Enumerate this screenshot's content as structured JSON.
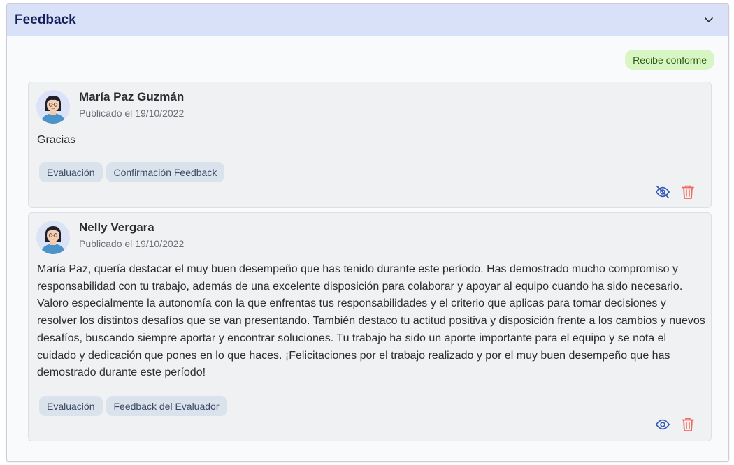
{
  "panel": {
    "title": "Feedback",
    "status": "Recibe conforme",
    "colors": {
      "header_bg": "#d9e1f8",
      "title": "#14205a",
      "badge_bg": "#d8f5c4",
      "badge_text": "#2e5b13",
      "icon_blue": "#3357b8",
      "icon_red": "#f26a5e"
    },
    "icons": {
      "toggle": "chevron-down-icon"
    }
  },
  "comments": [
    {
      "author": "María Paz Guzmán",
      "published": "Publicado el 19/10/2022",
      "text": "Gracias",
      "tags": [
        "Evaluación",
        "Confirmación Feedback"
      ],
      "actions": {
        "visibility_icon": "eye-off-icon",
        "delete_icon": "trash-icon"
      }
    },
    {
      "author": "Nelly Vergara",
      "published": "Publicado el 19/10/2022",
      "text": "María Paz, quería destacar el muy buen desempeño que has tenido durante este período. Has demostrado mucho compromiso y responsabilidad con tu trabajo, además de una excelente disposición para colaborar y apoyar al equipo cuando ha sido necesario. Valoro especialmente la autonomía con la que enfrentas tus responsabilidades y el criterio que aplicas para tomar decisiones y resolver los distintos desafíos que se van presentando. También destaco tu actitud positiva y disposición frente a los cambios y nuevos desafíos, buscando siempre aportar y encontrar soluciones. Tu trabajo ha sido un aporte importante para el equipo y se nota el cuidado y dedicación que pones en lo que haces. ¡Felicitaciones por el trabajo realizado y por el muy buen desempeño que has demostrado durante este período!",
      "tags": [
        "Evaluación",
        "Feedback del Evaluador"
      ],
      "actions": {
        "visibility_icon": "eye-icon",
        "delete_icon": "trash-icon"
      }
    }
  ]
}
